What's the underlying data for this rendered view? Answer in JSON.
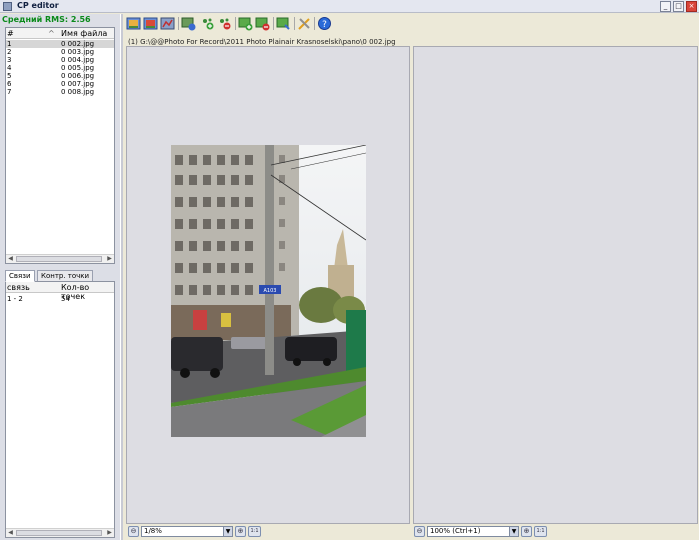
{
  "window": {
    "title": "CP editor",
    "buttons": {
      "minimize": "_",
      "maximize": "□",
      "close": "×"
    }
  },
  "left": {
    "rms_label": "Средний RMS: 2.56",
    "images_table": {
      "headers": {
        "index": "#",
        "filename": "Имя файла"
      },
      "rows": [
        {
          "index": "1",
          "filename": "0 002.jpg",
          "selected": true
        },
        {
          "index": "2",
          "filename": "0 003.jpg"
        },
        {
          "index": "3",
          "filename": "0 004.jpg"
        },
        {
          "index": "4",
          "filename": "0 005.jpg"
        },
        {
          "index": "5",
          "filename": "0 006.jpg"
        },
        {
          "index": "6",
          "filename": "0 007.jpg"
        },
        {
          "index": "7",
          "filename": "0 008.jpg"
        }
      ]
    },
    "tabs": [
      {
        "label": "Связи",
        "active": true
      },
      {
        "label": "Контр. точки"
      }
    ],
    "links_table": {
      "headers": {
        "link": "связь",
        "count": "Кол-во точек"
      },
      "rows": [
        {
          "link": "1 - 2",
          "count": "54"
        }
      ]
    }
  },
  "toolbar": {
    "icons": [
      "add-images-icon",
      "remove-images-icon",
      "optimize-icon",
      "detect-points-icon",
      "add-point-icon",
      "remove-point-icon",
      "add-points-green-icon",
      "remove-points-green-icon",
      "fit-icon",
      "settings-tools-icon",
      "help-icon"
    ]
  },
  "viewer": {
    "left_path": "(1) G:\\@@Photo For Record\\2011 Photo Plainair Krasnoselski\\pano\\0 002.jpg",
    "left_zoom": "1/8%",
    "right_zoom": "100% (Ctrl+1)",
    "zoom_btn_label": "1:1"
  },
  "colors": {
    "rms_green": "#0a8a1a",
    "panel_bg": "#dddde3"
  }
}
